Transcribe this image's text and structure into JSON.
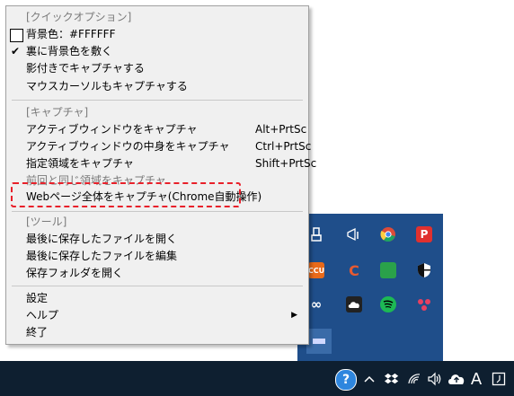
{
  "menu": {
    "sections": {
      "quick": {
        "header": "[クイックオプション]",
        "bg_color": "背景色：#FFFFFF",
        "paste_bg": "裏に背景色を敷く",
        "shadow": "影付きでキャプチャする",
        "cursor": "マウスカーソルもキャプチャする",
        "paste_bg_checked": true,
        "swatch_color": "#FFFFFF"
      },
      "capture": {
        "header": "[キャプチャ]",
        "items": [
          {
            "label": "アクティブウィンドウをキャプチャ",
            "shortcut": "Alt+PrtSc"
          },
          {
            "label": "アクティブウィンドウの中身をキャプチャ",
            "shortcut": "Ctrl+PrtSc"
          },
          {
            "label": "指定領域をキャプチャ",
            "shortcut": "Shift+PrtSc"
          },
          {
            "label": "前回と同じ領域をキャプチャ",
            "shortcut": ""
          },
          {
            "label": "Webページ全体をキャプチャ(Chrome自動操作)",
            "shortcut": ""
          }
        ]
      },
      "tools": {
        "header": "[ツール]",
        "items": [
          {
            "label": "最後に保存したファイルを開く"
          },
          {
            "label": "最後に保存したファイルを編集"
          },
          {
            "label": "保存フォルダを開く"
          }
        ]
      },
      "misc": {
        "settings": "設定",
        "help": "ヘルプ",
        "exit": "終了"
      }
    },
    "highlight_color": "#E8202A"
  },
  "tray": {
    "background": "#1F4E8A",
    "icons": [
      "usb-icon",
      "flag-icon",
      "chrome-icon",
      "pin-icon",
      "ccu-icon",
      "c-icon",
      "green-app-icon",
      "shield-icon",
      "infinity-icon",
      "cloud-icon",
      "spotify-icon",
      "dots-icon",
      "app-icon"
    ]
  },
  "taskbar": {
    "background": "#0E1F30",
    "icons": [
      "help-icon",
      "chevron-up-icon",
      "dropbox-icon",
      "wifi-icon",
      "volume-icon",
      "cloud-upload-icon",
      "ime-icon",
      "notification-icon"
    ],
    "ime_label": "A",
    "help_label": "?"
  }
}
